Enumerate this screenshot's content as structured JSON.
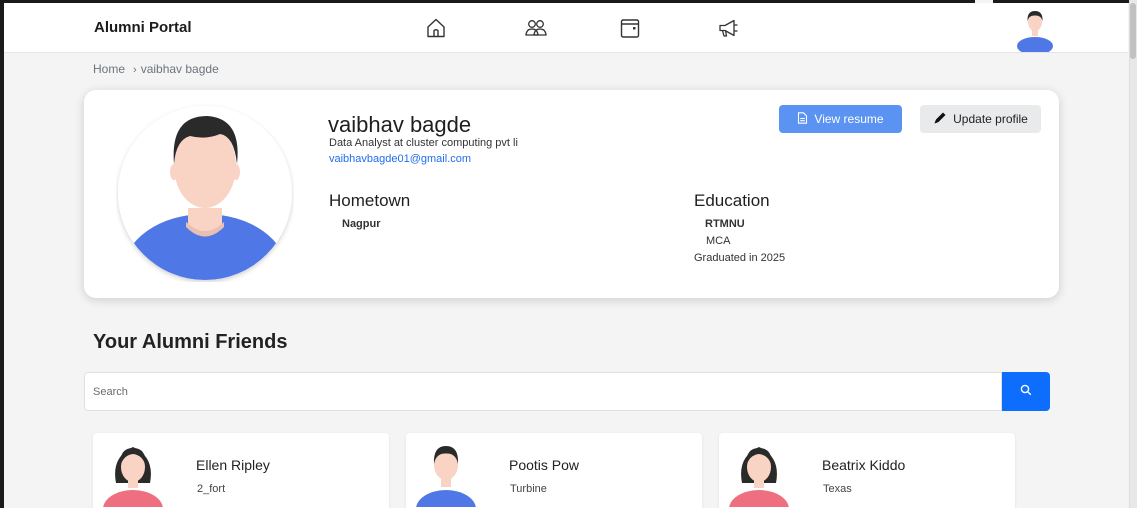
{
  "navbar": {
    "brand": "Alumni Portal",
    "icons": [
      "home-icon",
      "people-icon",
      "calendar-icon",
      "megaphone-icon"
    ]
  },
  "breadcrumb": {
    "home": "Home",
    "separator": "›",
    "current": "vaibhav bagde"
  },
  "profile": {
    "name": "vaibhav bagde",
    "role": "Data Analyst at cluster computing pvt li",
    "email": "vaibhavbagde01@gmail.com",
    "hometown_label": "Hometown",
    "hometown": "Nagpur",
    "education_label": "Education",
    "university": "RTMNU",
    "degree": "MCA",
    "graduated": "Graduated in 2025",
    "view_resume_label": "View resume",
    "update_profile_label": "Update profile"
  },
  "friends": {
    "title": "Your Alumni Friends",
    "search_placeholder": "Search",
    "items": [
      {
        "name": "Ellen Ripley",
        "location": "2_fort",
        "avatar": "female"
      },
      {
        "name": "Pootis Pow",
        "location": "Turbine",
        "avatar": "male"
      },
      {
        "name": "Beatrix Kiddo",
        "location": "Texas",
        "avatar": "female"
      }
    ]
  },
  "colors": {
    "primary": "#0d6efd",
    "resume_button": "#5b93f2",
    "link": "#1f6feb",
    "male_shirt": "#5077e6",
    "female_shirt": "#ee7080",
    "skin": "#f9d3c4",
    "hair": "#2a2a2a"
  }
}
